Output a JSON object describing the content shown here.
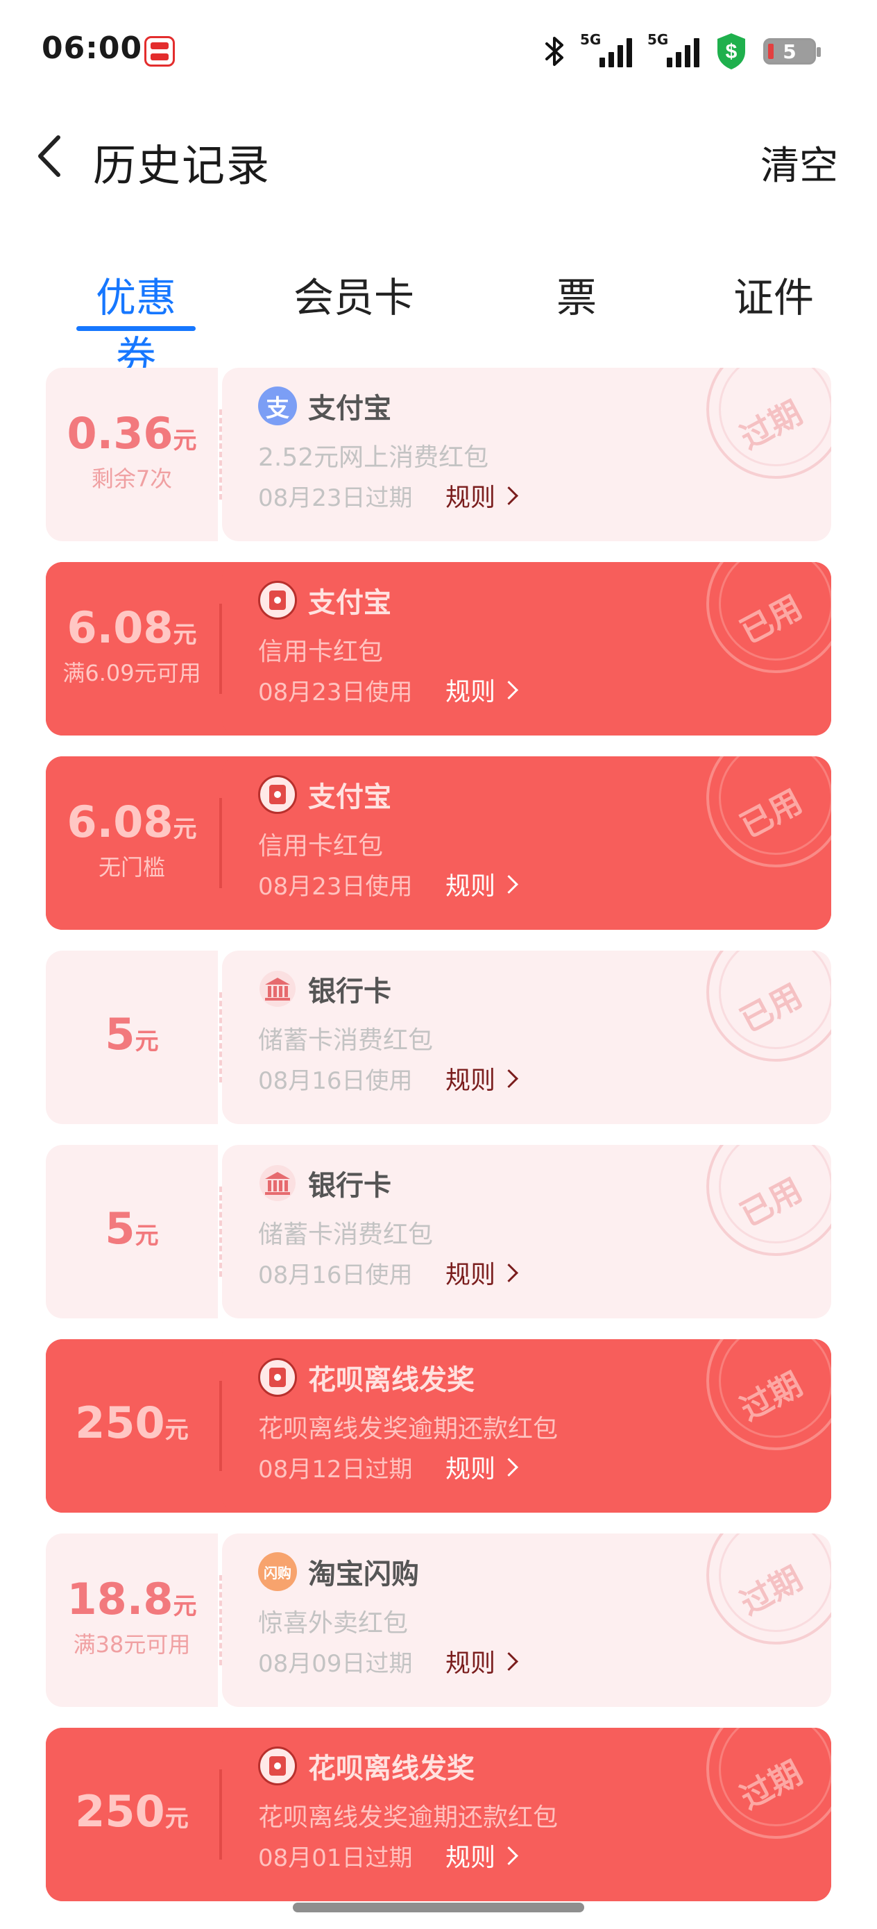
{
  "status_bar": {
    "time": "06:00",
    "network_1": "5G",
    "network_2": "5G",
    "battery_level": "5",
    "icons": [
      "app-icon",
      "bluetooth-icon",
      "signal-icon",
      "signal-icon",
      "security-shield-icon",
      "battery-icon"
    ],
    "colors": {
      "shield": "#1fb04d",
      "battery_low": "#e34040"
    }
  },
  "nav": {
    "title": "历史记录",
    "clear_label": "清空",
    "back_icon": "chevron-left-icon"
  },
  "tabs": [
    {
      "label": "优惠券",
      "active": true
    },
    {
      "label": "会员卡",
      "active": false
    },
    {
      "label": "票",
      "active": false
    },
    {
      "label": "证件",
      "active": false
    }
  ],
  "accent_color": "#1677ff",
  "rule_label": "规则",
  "coupons": [
    {
      "amount": "0.36",
      "unit": "元",
      "subtext": "剩余7次",
      "merchant": "支付宝",
      "logo": "alipay-icon",
      "desc": "2.52元网上消费红包",
      "date": "08月23日过期",
      "stamp": "过期",
      "style": "light"
    },
    {
      "amount": "6.08",
      "unit": "元",
      "subtext": "满6.09元可用",
      "merchant": "支付宝",
      "logo": "red-packet-icon",
      "desc": "信用卡红包",
      "date": "08月23日使用",
      "stamp": "已用",
      "style": "red"
    },
    {
      "amount": "6.08",
      "unit": "元",
      "subtext": "无门槛",
      "merchant": "支付宝",
      "logo": "red-packet-icon",
      "desc": "信用卡红包",
      "date": "08月23日使用",
      "stamp": "已用",
      "style": "red"
    },
    {
      "amount": "5",
      "unit": "元",
      "subtext": "",
      "merchant": "银行卡",
      "logo": "bank-icon",
      "desc": "储蓄卡消费红包",
      "date": "08月16日使用",
      "stamp": "已用",
      "style": "light"
    },
    {
      "amount": "5",
      "unit": "元",
      "subtext": "",
      "merchant": "银行卡",
      "logo": "bank-icon",
      "desc": "储蓄卡消费红包",
      "date": "08月16日使用",
      "stamp": "已用",
      "style": "light"
    },
    {
      "amount": "250",
      "unit": "元",
      "subtext": "",
      "merchant": "花呗离线发奖",
      "logo": "red-packet-icon",
      "desc": "花呗离线发奖逾期还款红包",
      "date": "08月12日过期",
      "stamp": "过期",
      "style": "red"
    },
    {
      "amount": "18.8",
      "unit": "元",
      "subtext": "满38元可用",
      "merchant": "淘宝闪购",
      "logo": "taobao-flash-icon",
      "logo_text": "闪购",
      "desc": "惊喜外卖红包",
      "date": "08月09日过期",
      "stamp": "过期",
      "style": "light"
    },
    {
      "amount": "250",
      "unit": "元",
      "subtext": "",
      "merchant": "花呗离线发奖",
      "logo": "red-packet-icon",
      "desc": "花呗离线发奖逾期还款红包",
      "date": "08月01日过期",
      "stamp": "过期",
      "style": "red"
    }
  ],
  "colors": {
    "coupon_red": "#f75e5b",
    "coupon_light": "#fdeff0"
  }
}
